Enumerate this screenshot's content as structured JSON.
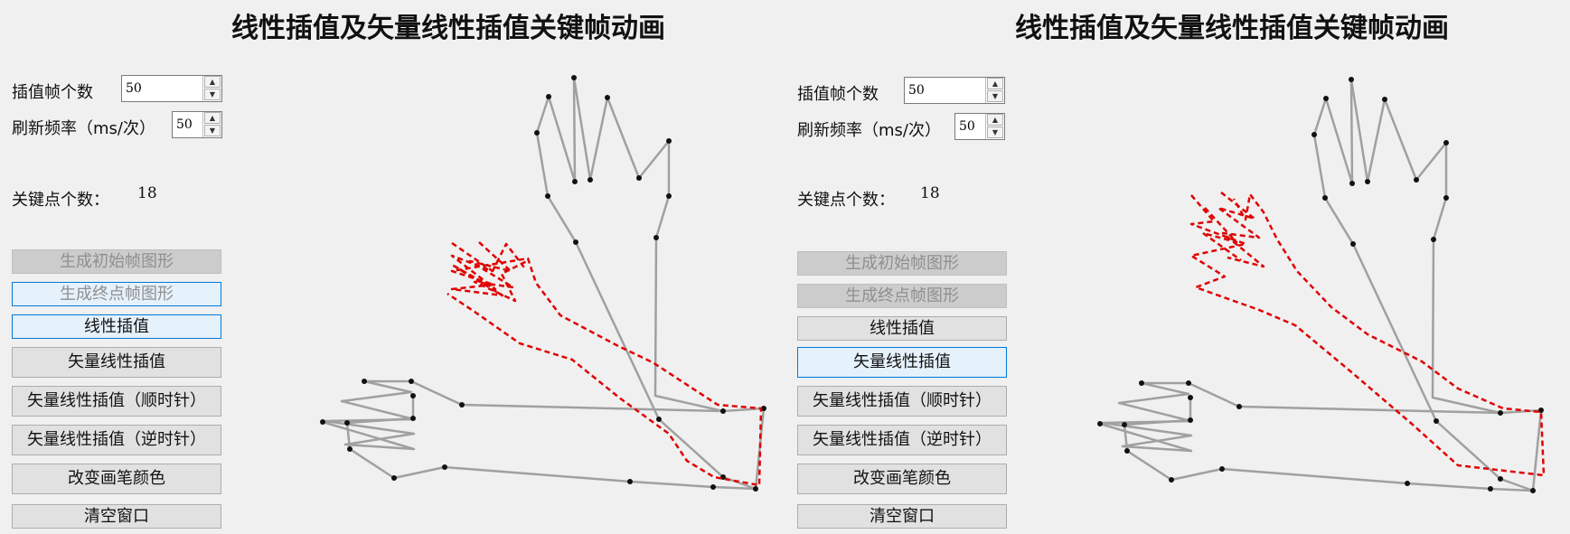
{
  "left": {
    "title": "线性插值及矢量线性插值关键帧动画",
    "frames_label": "插值帧个数",
    "frames_value": "50",
    "refresh_label": "刷新频率（ms/次）",
    "refresh_value": "50",
    "keypoints_label": "关键点个数：",
    "keypoints_value": "18",
    "buttons": {
      "gen_start": "生成初始帧图形",
      "gen_end": "生成终点帧图形",
      "linear": "线性插值",
      "vector": "矢量线性插值",
      "vector_cw": "矢量线性插值（顺时针）",
      "vector_ccw": "矢量线性插值（逆时针）",
      "pen_color": "改变画笔颜色",
      "clear": "清空窗口"
    }
  },
  "right": {
    "title": "线性插值及矢量线性插值关键帧动画",
    "frames_label": "插值帧个数",
    "frames_value": "50",
    "refresh_label": "刷新频率（ms/次）",
    "refresh_value": "50",
    "keypoints_label": "关键点个数：",
    "keypoints_value": "18",
    "buttons": {
      "gen_start": "生成初始帧图形",
      "gen_end": "生成终点帧图形",
      "linear": "线性插值",
      "vector": "矢量线性插值",
      "vector_cw": "矢量线性插值（顺时针）",
      "vector_ccw": "矢量线性插值（逆时针）",
      "pen_color": "改变画笔颜色",
      "clear": "清空窗口"
    }
  },
  "colors": {
    "shape": "#a0a0a0",
    "interp": "#e00000",
    "point": "#111111",
    "focus": "#0078d7"
  }
}
